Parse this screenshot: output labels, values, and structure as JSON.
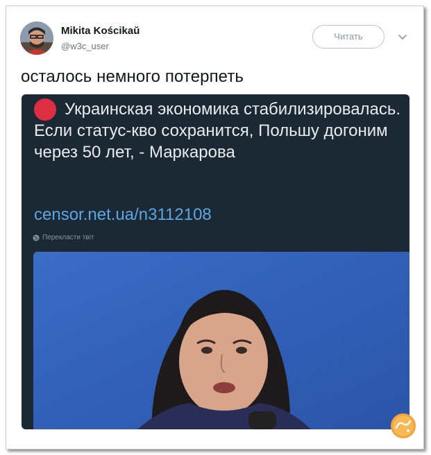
{
  "author": {
    "name": "Mikita Kościkaŭ",
    "handle": "@w3c_user"
  },
  "follow_label": "Читать",
  "tweet_text": "осталось немного потерпеть",
  "quoted": {
    "text": "Украинская экономика стабилизировалась. Если статус-кво сохранится, Польшу догоним через 50 лет, - Маркарова",
    "link": "censor.net.ua/n3112108",
    "translate_label": "Перекласти твіт"
  },
  "watermark": "fishka",
  "colors": {
    "embed_bg": "#1c2833",
    "link": "#5aa7e6",
    "red_dot": "#dd2e44",
    "photo_bg": "#2e5fb8"
  },
  "icons": [
    "avatar",
    "chevron-down-icon",
    "globe-icon",
    "red-circle-emoji",
    "watermark-logo"
  ]
}
